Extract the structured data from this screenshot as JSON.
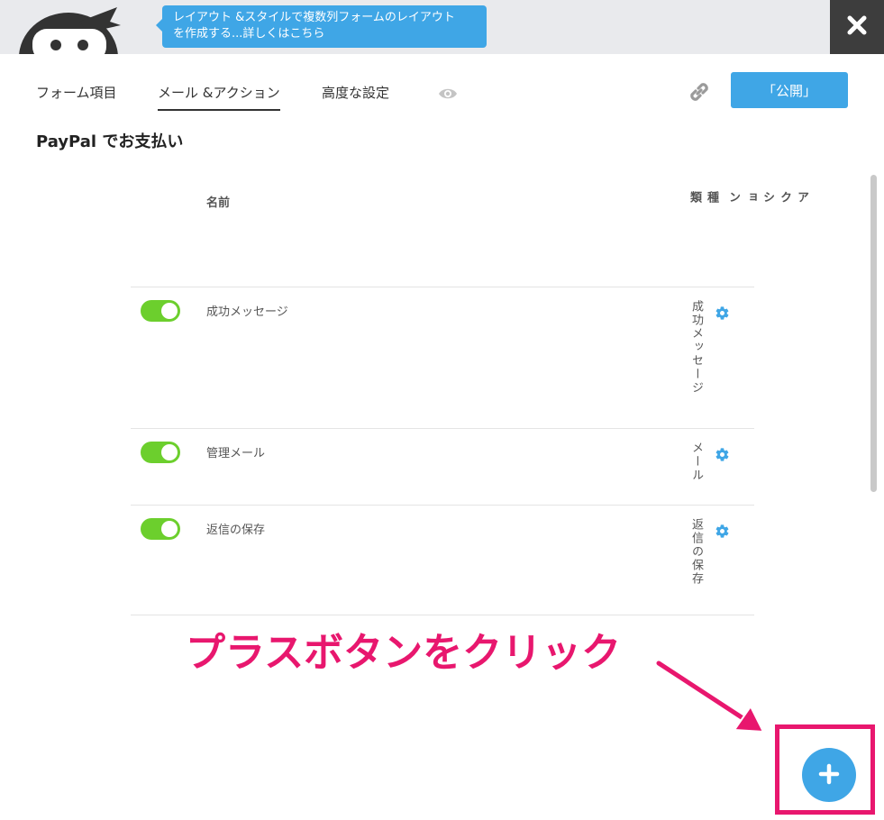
{
  "header": {
    "tooltip_line1": "レイアウト &スタイルで複数列フォームのレイアウト",
    "tooltip_line2": "を作成する...詳しくはこちら",
    "close_icon": "close-icon"
  },
  "tabs": [
    {
      "label": "フォーム項目",
      "active": false
    },
    {
      "label": "メール &アクション",
      "active": true
    },
    {
      "label": "高度な設定",
      "active": false
    }
  ],
  "toolbar": {
    "publish_label": "「公開」",
    "preview_icon": "eye-icon",
    "link_icon": "link-icon"
  },
  "form_title": "PayPal でお支払い",
  "table": {
    "headers": {
      "name": "名前",
      "type": "種類",
      "action": "アクション"
    },
    "rows": [
      {
        "enabled": true,
        "name": "成功メッセージ",
        "type": "成功メッセージ"
      },
      {
        "enabled": true,
        "name": "管理メール",
        "type": "メール"
      },
      {
        "enabled": true,
        "name": "返信の保存",
        "type": "返信の保存"
      }
    ]
  },
  "annotation": {
    "text": "プラスボタンをクリック",
    "color": "#e8176e"
  },
  "add_button_icon": "plus-icon",
  "colors": {
    "accent": "#3fa6e6",
    "toggle_on": "#6ccf2d",
    "topbar": "#e9eaed"
  }
}
